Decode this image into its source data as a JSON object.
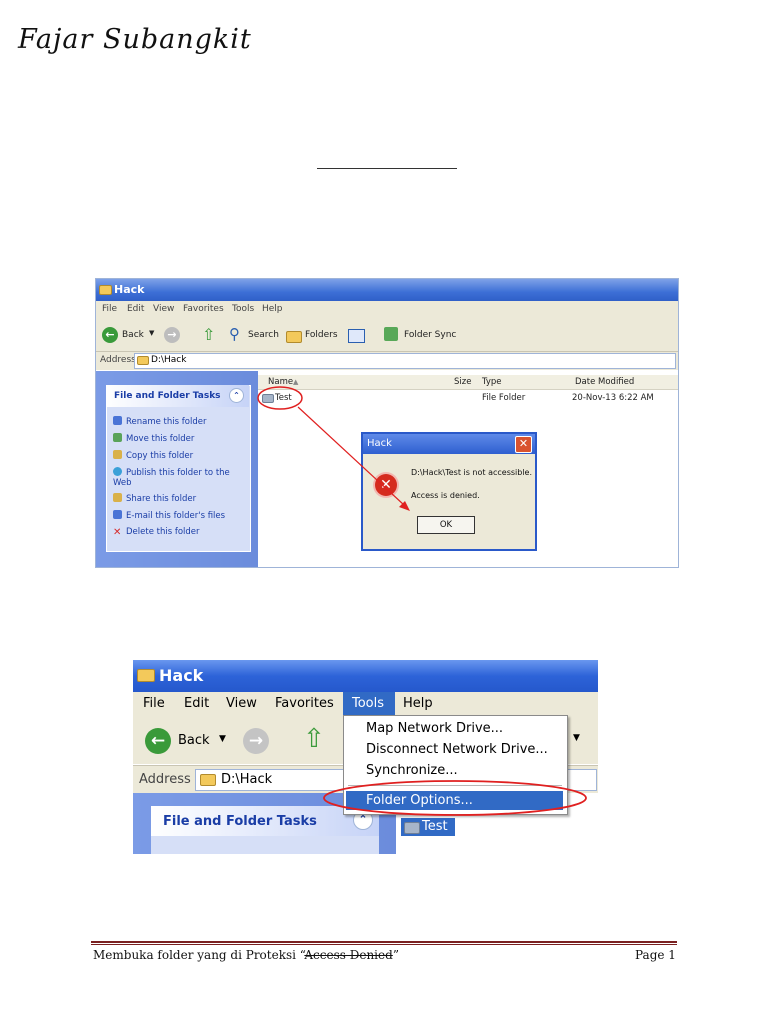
{
  "header": {
    "author": "Fajar Subangkit"
  },
  "shot1": {
    "window_title": "Hack",
    "menu": [
      "File",
      "Edit",
      "View",
      "Favorites",
      "Tools",
      "Help"
    ],
    "toolbar": {
      "back": "Back",
      "search": "Search",
      "folders": "Folders",
      "folder_sync": "Folder Sync"
    },
    "address_label": "Address",
    "address_value": "D:\\Hack",
    "tasks_title": "File and Folder Tasks",
    "tasks": [
      {
        "label": "Rename this folder",
        "icon": "rename-icon",
        "color": "#4a74d6"
      },
      {
        "label": "Move this folder",
        "icon": "move-icon",
        "color": "#5aa35a"
      },
      {
        "label": "Copy this folder",
        "icon": "copy-icon",
        "color": "#d9b14a"
      },
      {
        "label": "Publish this folder to the Web",
        "icon": "globe-icon",
        "color": "#3aa0d8"
      },
      {
        "label": "Share this folder",
        "icon": "share-icon",
        "color": "#d9b14a"
      },
      {
        "label": "E-mail this folder's files",
        "icon": "email-icon",
        "color": "#4a74d6"
      },
      {
        "label": "Delete this folder",
        "icon": "delete-icon",
        "color": "#d62a2a"
      }
    ],
    "columns": {
      "name": "Name",
      "size": "Size",
      "type": "Type",
      "date": "Date Modified"
    },
    "row": {
      "name": "Test",
      "type": "File Folder",
      "date": "20-Nov-13 6:22 AM"
    },
    "dialog": {
      "title": "Hack",
      "message1": "D:\\Hack\\Test is not accessible.",
      "message2": "Access is denied.",
      "ok": "OK"
    },
    "annotation_color": "#e02020"
  },
  "shot2": {
    "window_title": "Hack",
    "menu": [
      "File",
      "Edit",
      "View",
      "Favorites",
      "Tools",
      "Help"
    ],
    "back": "Back",
    "address_label": "Address",
    "address_value": "D:\\Hack",
    "tasks_title": "File and Folder Tasks",
    "tools_menu": [
      "Map Network Drive...",
      "Disconnect Network Drive...",
      "Synchronize...",
      "Folder Options..."
    ],
    "row_name": "Test"
  },
  "footer": {
    "left_prefix": "Membuka folder yang di Proteksi “",
    "left_strike": "Access Denied",
    "left_suffix": "”",
    "right": "Page 1"
  }
}
